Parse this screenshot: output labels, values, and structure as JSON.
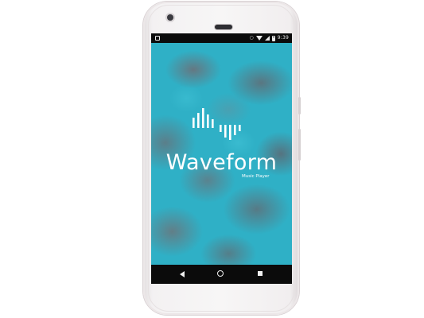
{
  "status_bar": {
    "time": "9:39"
  },
  "app": {
    "title": "Waveform",
    "subtitle": "Music Player"
  },
  "colors": {
    "splash_background": "#2fb0c6",
    "cloud_gray": "#6e6e76",
    "logo_text": "#ffffff"
  },
  "icons": {
    "notification": "notification-icon",
    "key": "key-icon",
    "wifi": "wifi-icon",
    "signal": "signal-icon",
    "battery": "battery-icon",
    "back": "back-icon",
    "home": "home-icon",
    "recents": "recents-icon",
    "logo": "waveform-logo-icon"
  }
}
